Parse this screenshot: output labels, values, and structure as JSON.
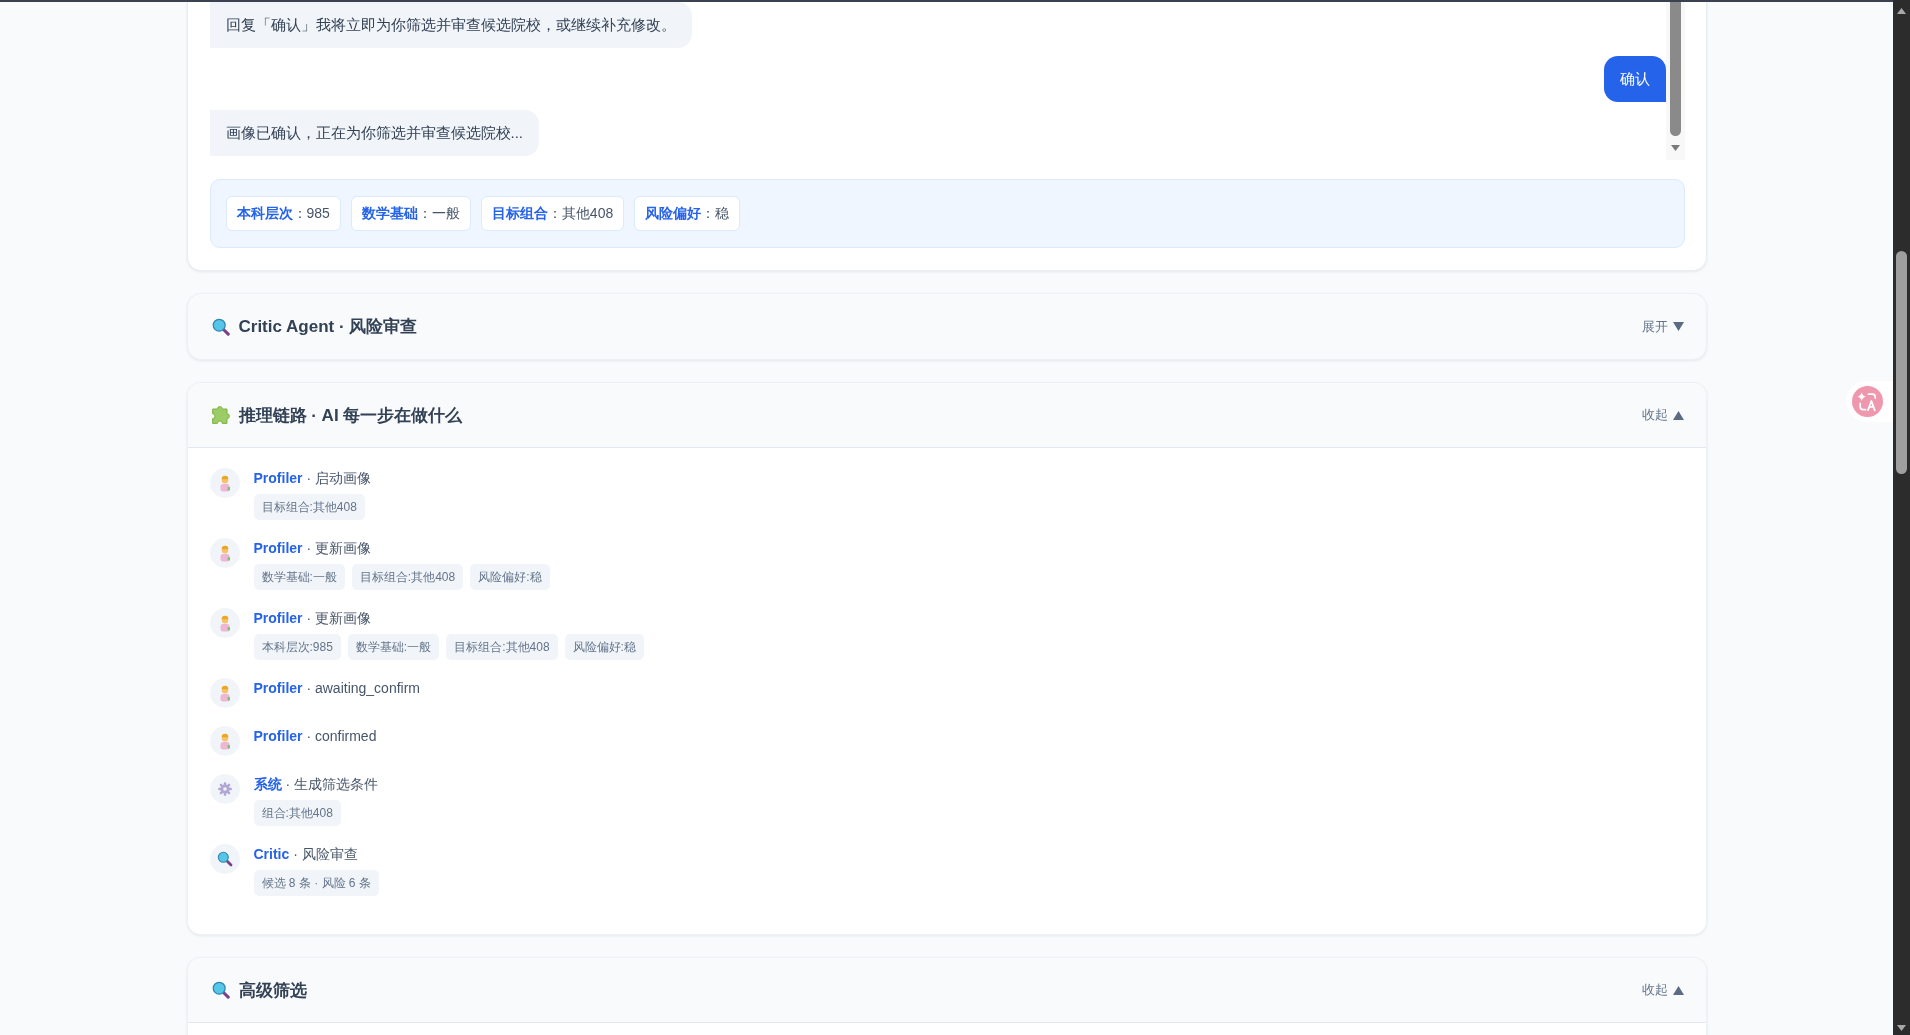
{
  "chat": {
    "messages": [
      {
        "kind": "bot",
        "text": "回复「确认」我将立即为你筛选并审查候选院校，或继续补充修改。"
      },
      {
        "kind": "user",
        "text": "确认"
      },
      {
        "kind": "bot",
        "text": "画像已确认，正在为你筛选并审查候选院校..."
      }
    ],
    "profile_tags": [
      "**本科层次**：985",
      "**数学基础**：一般",
      "**目标组合**：其他408",
      "**风险偏好**：稳"
    ]
  },
  "panels": [
    {
      "kind": "critic",
      "title": "Critic Agent · 风险审查",
      "expanded": false,
      "toggle": "展开"
    },
    {
      "kind": "chain",
      "title": "推理链路 · AI 每一步在做什么",
      "expanded": true,
      "toggle": "收起",
      "steps": [
        {
          "kind": "profiler",
          "text": "**Profiler** · 启动画像",
          "tags": [
            "目标组合:其他408"
          ]
        },
        {
          "kind": "profiler",
          "text": "**Profiler** · 更新画像",
          "tags": [
            "数学基础:一般",
            "目标组合:其他408",
            "风险偏好:稳"
          ]
        },
        {
          "kind": "profiler",
          "text": "**Profiler** · 更新画像",
          "tags": [
            "本科层次:985",
            "数学基础:一般",
            "目标组合:其他408",
            "风险偏好:稳"
          ]
        },
        {
          "kind": "profiler",
          "text": "**Profiler** · awaiting_confirm"
        },
        {
          "kind": "profiler",
          "text": "**Profiler** · confirmed"
        },
        {
          "kind": "system",
          "text": "**系统** · 生成筛选条件",
          "tags": [
            "组合:其他408"
          ]
        },
        {
          "kind": "critic",
          "text": "**Critic** · 风险审查",
          "tags": [
            "候选 8 条 · 风险 6 条"
          ]
        }
      ]
    },
    {
      "kind": "filter",
      "title": "高级筛选",
      "expanded": true,
      "toggle": "收起"
    }
  ]
}
